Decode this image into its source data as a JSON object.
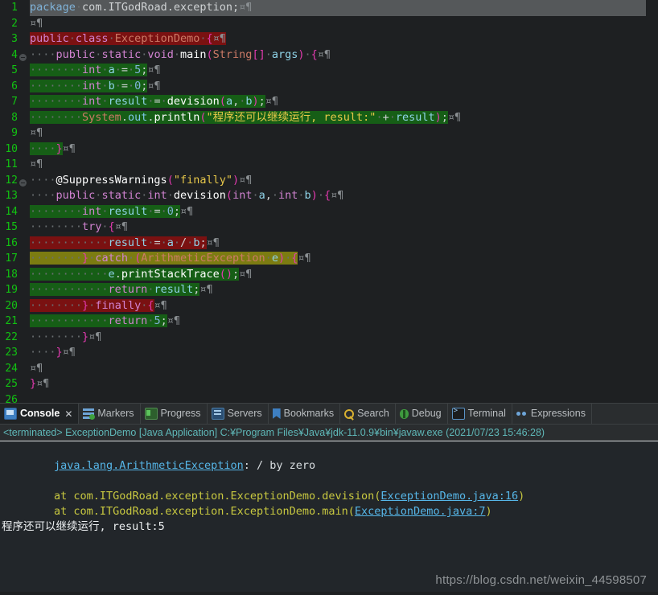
{
  "editor": {
    "language": "java",
    "lines": [
      {
        "n": "1",
        "fold": false,
        "hl": "gray",
        "indent": 0,
        "tokens": [
          {
            "t": "package",
            "c": "kw2"
          },
          {
            "t": "·",
            "c": "dot"
          },
          {
            "t": "com.ITGodRoad.exception",
            "c": "plain"
          },
          {
            "t": ";",
            "c": "plain"
          },
          {
            "t": "¤¶",
            "c": "pilc"
          }
        ]
      },
      {
        "n": "2",
        "fold": false,
        "hl": "none",
        "indent": 0,
        "tokens": [
          {
            "t": "¤¶",
            "c": "pilc"
          }
        ]
      },
      {
        "n": "3",
        "fold": false,
        "hl": "red",
        "indent": 0,
        "tokens": [
          {
            "t": "public",
            "c": "kw"
          },
          {
            "t": "·",
            "c": "dot"
          },
          {
            "t": "class",
            "c": "kw"
          },
          {
            "t": "·",
            "c": "dot"
          },
          {
            "t": "ExceptionDemo",
            "c": "typ"
          },
          {
            "t": "·",
            "c": "dot"
          },
          {
            "t": "{",
            "c": "pun"
          },
          {
            "t": "¤¶",
            "c": "pilc"
          }
        ]
      },
      {
        "n": "4",
        "fold": true,
        "hl": "none",
        "indent": 0,
        "tokens": [
          {
            "t": "····",
            "c": "dot"
          },
          {
            "t": "public",
            "c": "kw"
          },
          {
            "t": "·",
            "c": "dot"
          },
          {
            "t": "static",
            "c": "kw"
          },
          {
            "t": "·",
            "c": "dot"
          },
          {
            "t": "void",
            "c": "kw"
          },
          {
            "t": "·",
            "c": "dot"
          },
          {
            "t": "main",
            "c": "fn"
          },
          {
            "t": "(",
            "c": "pun"
          },
          {
            "t": "String",
            "c": "typ"
          },
          {
            "t": "[]",
            "c": "pun"
          },
          {
            "t": "·",
            "c": "dot"
          },
          {
            "t": "args",
            "c": "var"
          },
          {
            "t": ")",
            "c": "pun"
          },
          {
            "t": "·",
            "c": "dot"
          },
          {
            "t": "{",
            "c": "pun"
          },
          {
            "t": "¤¶",
            "c": "pilc"
          }
        ]
      },
      {
        "n": "5",
        "fold": false,
        "hl": "green",
        "indent": 0,
        "tokens": [
          {
            "t": "········",
            "c": "dot"
          },
          {
            "t": "int",
            "c": "kw"
          },
          {
            "t": "·",
            "c": "dot"
          },
          {
            "t": "a",
            "c": "var"
          },
          {
            "t": "·",
            "c": "dot"
          },
          {
            "t": "=",
            "c": "plain"
          },
          {
            "t": "·",
            "c": "dot"
          },
          {
            "t": "5",
            "c": "num"
          },
          {
            "t": ";",
            "c": "plain"
          },
          {
            "t": "¤¶",
            "c": "pilc",
            "nohl": true
          }
        ]
      },
      {
        "n": "6",
        "fold": false,
        "hl": "green",
        "indent": 0,
        "tokens": [
          {
            "t": "········",
            "c": "dot"
          },
          {
            "t": "int",
            "c": "kw"
          },
          {
            "t": "·",
            "c": "dot"
          },
          {
            "t": "b",
            "c": "var"
          },
          {
            "t": "·",
            "c": "dot"
          },
          {
            "t": "=",
            "c": "plain"
          },
          {
            "t": "·",
            "c": "dot"
          },
          {
            "t": "0",
            "c": "num"
          },
          {
            "t": ";",
            "c": "plain"
          },
          {
            "t": "¤¶",
            "c": "pilc",
            "nohl": true
          }
        ]
      },
      {
        "n": "7",
        "fold": false,
        "hl": "green",
        "indent": 0,
        "tokens": [
          {
            "t": "········",
            "c": "dot"
          },
          {
            "t": "int",
            "c": "kw"
          },
          {
            "t": "·",
            "c": "dot"
          },
          {
            "t": "result",
            "c": "var"
          },
          {
            "t": "·",
            "c": "dot"
          },
          {
            "t": "=",
            "c": "plain"
          },
          {
            "t": "·",
            "c": "dot"
          },
          {
            "t": "devision",
            "c": "fn"
          },
          {
            "t": "(",
            "c": "pun"
          },
          {
            "t": "a",
            "c": "var"
          },
          {
            "t": ",",
            "c": "plain"
          },
          {
            "t": "·",
            "c": "dot"
          },
          {
            "t": "b",
            "c": "var"
          },
          {
            "t": ")",
            "c": "pun"
          },
          {
            "t": ";",
            "c": "plain"
          },
          {
            "t": "¤¶",
            "c": "pilc",
            "nohl": true
          }
        ]
      },
      {
        "n": "8",
        "fold": false,
        "hl": "green",
        "indent": 0,
        "tokens": [
          {
            "t": "········",
            "c": "dot"
          },
          {
            "t": "System",
            "c": "typ"
          },
          {
            "t": ".",
            "c": "plain"
          },
          {
            "t": "out",
            "c": "fieldv"
          },
          {
            "t": ".",
            "c": "plain"
          },
          {
            "t": "println",
            "c": "fn"
          },
          {
            "t": "(",
            "c": "pun"
          },
          {
            "t": "\"程序还可以继续运行, result:\"",
            "c": "str"
          },
          {
            "t": "·",
            "c": "dot"
          },
          {
            "t": "+",
            "c": "plain"
          },
          {
            "t": "·",
            "c": "dot"
          },
          {
            "t": "result",
            "c": "var"
          },
          {
            "t": ")",
            "c": "pun"
          },
          {
            "t": ";",
            "c": "plain"
          },
          {
            "t": "¤¶",
            "c": "pilc",
            "nohl": true
          }
        ]
      },
      {
        "n": "9",
        "fold": false,
        "hl": "none",
        "indent": 0,
        "tokens": [
          {
            "t": "¤¶",
            "c": "pilc"
          }
        ]
      },
      {
        "n": "10",
        "fold": false,
        "hl": "green",
        "indent": 0,
        "tokens": [
          {
            "t": "····",
            "c": "dot"
          },
          {
            "t": "}",
            "c": "pun"
          },
          {
            "t": "¤¶",
            "c": "pilc",
            "nohl": true
          }
        ]
      },
      {
        "n": "11",
        "fold": false,
        "hl": "none",
        "indent": 0,
        "tokens": [
          {
            "t": "¤¶",
            "c": "pilc"
          }
        ]
      },
      {
        "n": "12",
        "fold": true,
        "hl": "none",
        "indent": 0,
        "tokens": [
          {
            "t": "····",
            "c": "dot"
          },
          {
            "t": "@SuppressWarnings",
            "c": "ann"
          },
          {
            "t": "(",
            "c": "pun"
          },
          {
            "t": "\"finally\"",
            "c": "str"
          },
          {
            "t": ")",
            "c": "pun"
          },
          {
            "t": "¤¶",
            "c": "pilc"
          }
        ]
      },
      {
        "n": "13",
        "fold": false,
        "hl": "none",
        "indent": 0,
        "tokens": [
          {
            "t": "····",
            "c": "dot"
          },
          {
            "t": "public",
            "c": "kw"
          },
          {
            "t": "·",
            "c": "dot"
          },
          {
            "t": "static",
            "c": "kw"
          },
          {
            "t": "·",
            "c": "dot"
          },
          {
            "t": "int",
            "c": "kw"
          },
          {
            "t": "·",
            "c": "dot"
          },
          {
            "t": "devision",
            "c": "fn"
          },
          {
            "t": "(",
            "c": "pun"
          },
          {
            "t": "int",
            "c": "kw"
          },
          {
            "t": "·",
            "c": "dot"
          },
          {
            "t": "a",
            "c": "var"
          },
          {
            "t": ",",
            "c": "plain"
          },
          {
            "t": "·",
            "c": "dot"
          },
          {
            "t": "int",
            "c": "kw"
          },
          {
            "t": "·",
            "c": "dot"
          },
          {
            "t": "b",
            "c": "var"
          },
          {
            "t": ")",
            "c": "pun"
          },
          {
            "t": "·",
            "c": "dot"
          },
          {
            "t": "{",
            "c": "pun"
          },
          {
            "t": "¤¶",
            "c": "pilc"
          }
        ]
      },
      {
        "n": "14",
        "fold": false,
        "hl": "green",
        "indent": 0,
        "tokens": [
          {
            "t": "········",
            "c": "dot"
          },
          {
            "t": "int",
            "c": "kw"
          },
          {
            "t": "·",
            "c": "dot"
          },
          {
            "t": "result",
            "c": "var"
          },
          {
            "t": "·",
            "c": "dot"
          },
          {
            "t": "=",
            "c": "plain"
          },
          {
            "t": "·",
            "c": "dot"
          },
          {
            "t": "0",
            "c": "num"
          },
          {
            "t": ";",
            "c": "plain"
          },
          {
            "t": "¤¶",
            "c": "pilc",
            "nohl": true
          }
        ]
      },
      {
        "n": "15",
        "fold": false,
        "hl": "none",
        "indent": 0,
        "tokens": [
          {
            "t": "········",
            "c": "dot"
          },
          {
            "t": "try",
            "c": "kw"
          },
          {
            "t": "·",
            "c": "dot"
          },
          {
            "t": "{",
            "c": "pun"
          },
          {
            "t": "¤¶",
            "c": "pilc"
          }
        ]
      },
      {
        "n": "16",
        "fold": false,
        "hl": "red",
        "indent": 0,
        "tokens": [
          {
            "t": "············",
            "c": "dot"
          },
          {
            "t": "result",
            "c": "var"
          },
          {
            "t": "·",
            "c": "dot"
          },
          {
            "t": "=",
            "c": "plain"
          },
          {
            "t": "·",
            "c": "dot"
          },
          {
            "t": "a",
            "c": "var"
          },
          {
            "t": "·",
            "c": "dot"
          },
          {
            "t": "/",
            "c": "plain"
          },
          {
            "t": "·",
            "c": "dot"
          },
          {
            "t": "b",
            "c": "var"
          },
          {
            "t": ";",
            "c": "plain"
          },
          {
            "t": "¤¶",
            "c": "pilc",
            "nohl": true
          }
        ]
      },
      {
        "n": "17",
        "fold": false,
        "hl": "olive",
        "indent": 0,
        "tokens": [
          {
            "t": "········",
            "c": "dot"
          },
          {
            "t": "}",
            "c": "pun"
          },
          {
            "t": "·",
            "c": "dot"
          },
          {
            "t": "catch",
            "c": "kw"
          },
          {
            "t": "·",
            "c": "dot"
          },
          {
            "t": "(",
            "c": "pun"
          },
          {
            "t": "ArithmeticException",
            "c": "typ"
          },
          {
            "t": "·",
            "c": "dot"
          },
          {
            "t": "e",
            "c": "var"
          },
          {
            "t": ")",
            "c": "pun"
          },
          {
            "t": "·",
            "c": "dot"
          },
          {
            "t": "{",
            "c": "pun"
          },
          {
            "t": "¤¶",
            "c": "pilc",
            "nohl": true
          }
        ]
      },
      {
        "n": "18",
        "fold": false,
        "hl": "green",
        "indent": 0,
        "tokens": [
          {
            "t": "············",
            "c": "dot"
          },
          {
            "t": "e",
            "c": "var"
          },
          {
            "t": ".",
            "c": "plain"
          },
          {
            "t": "printStackTrace",
            "c": "fn"
          },
          {
            "t": "(",
            "c": "pun"
          },
          {
            "t": ")",
            "c": "pun"
          },
          {
            "t": ";",
            "c": "plain"
          },
          {
            "t": "¤¶",
            "c": "pilc",
            "nohl": true
          }
        ]
      },
      {
        "n": "19",
        "fold": false,
        "hl": "green",
        "indent": 0,
        "tokens": [
          {
            "t": "············",
            "c": "dot"
          },
          {
            "t": "return",
            "c": "kw"
          },
          {
            "t": "·",
            "c": "dot"
          },
          {
            "t": "result",
            "c": "var"
          },
          {
            "t": ";",
            "c": "plain"
          },
          {
            "t": "¤¶",
            "c": "pilc",
            "nohl": true
          }
        ]
      },
      {
        "n": "20",
        "fold": false,
        "hl": "red",
        "indent": 0,
        "tokens": [
          {
            "t": "········",
            "c": "dot"
          },
          {
            "t": "}",
            "c": "pun"
          },
          {
            "t": "·",
            "c": "dot"
          },
          {
            "t": "finally",
            "c": "kw"
          },
          {
            "t": "·",
            "c": "dot"
          },
          {
            "t": "{",
            "c": "pun"
          },
          {
            "t": "¤¶",
            "c": "pilc",
            "nohl": true
          }
        ]
      },
      {
        "n": "21",
        "fold": false,
        "hl": "green",
        "indent": 0,
        "tokens": [
          {
            "t": "············",
            "c": "dot"
          },
          {
            "t": "return",
            "c": "kw"
          },
          {
            "t": "·",
            "c": "dot"
          },
          {
            "t": "5",
            "c": "num"
          },
          {
            "t": ";",
            "c": "plain"
          },
          {
            "t": "¤¶",
            "c": "pilc",
            "nohl": true
          }
        ]
      },
      {
        "n": "22",
        "fold": false,
        "hl": "none",
        "indent": 0,
        "tokens": [
          {
            "t": "········",
            "c": "dot"
          },
          {
            "t": "}",
            "c": "pun"
          },
          {
            "t": "¤¶",
            "c": "pilc"
          }
        ]
      },
      {
        "n": "23",
        "fold": false,
        "hl": "none",
        "indent": 0,
        "tokens": [
          {
            "t": "····",
            "c": "dot"
          },
          {
            "t": "}",
            "c": "pun"
          },
          {
            "t": "¤¶",
            "c": "pilc"
          }
        ]
      },
      {
        "n": "24",
        "fold": false,
        "hl": "none",
        "indent": 0,
        "tokens": [
          {
            "t": "¤¶",
            "c": "pilc"
          }
        ]
      },
      {
        "n": "25",
        "fold": false,
        "hl": "none",
        "indent": 0,
        "tokens": [
          {
            "t": "}",
            "c": "pun"
          },
          {
            "t": "¤¶",
            "c": "pilc"
          }
        ]
      },
      {
        "n": "26",
        "fold": false,
        "hl": "none",
        "indent": 0,
        "tokens": []
      }
    ]
  },
  "panel": {
    "tabs": [
      {
        "label": "Console",
        "icon": "console-monitor-icon",
        "active": true,
        "closable": true
      },
      {
        "label": "Markers",
        "icon": "markers-icon",
        "active": false,
        "closable": false
      },
      {
        "label": "Progress",
        "icon": "progress-icon",
        "active": false,
        "closable": false
      },
      {
        "label": "Servers",
        "icon": "servers-icon",
        "active": false,
        "closable": false
      },
      {
        "label": "Bookmarks",
        "icon": "bookmark-icon",
        "active": false,
        "closable": false
      },
      {
        "label": "Search",
        "icon": "search-icon",
        "active": false,
        "closable": false
      },
      {
        "label": "Debug",
        "icon": "debug-bug-icon",
        "active": false,
        "closable": false
      },
      {
        "label": "Terminal",
        "icon": "terminal-icon",
        "active": false,
        "closable": false
      },
      {
        "label": "Expressions",
        "icon": "expressions-icon",
        "active": false,
        "closable": false
      }
    ],
    "close_glyph": "✕",
    "launch_header": "<terminated> ExceptionDemo [Java Application] C:¥Program Files¥Java¥jdk-11.0.9¥bin¥javaw.exe (2021/07/23 15:46:28)",
    "console": {
      "exception_type": "java.lang.ArithmeticException",
      "exception_message": ": / by zero",
      "stack": [
        {
          "prefix": "        at com.ITGodRoad.exception.ExceptionDemo.devision(",
          "link": "ExceptionDemo.java:16",
          "suffix": ")"
        },
        {
          "prefix": "        at com.ITGodRoad.exception.ExceptionDemo.main(",
          "link": "ExceptionDemo.java:7",
          "suffix": ")"
        }
      ],
      "stdout": "程序还可以继续运行, result:5"
    }
  },
  "watermark": {
    "text": "https://blog.csdn.net/weixin_44598507"
  },
  "colors": {
    "editor_bg": "#1e2022",
    "panel_bg": "#2a2d2f",
    "console_bg": "#22262a",
    "line_number": "#12c212",
    "hl_green": "#165e16",
    "hl_red": "#7a1111",
    "hl_olive": "#7c7c11",
    "hl_gray": "#55585a",
    "link": "#56b6e8",
    "trace": "#c8c840",
    "string": "#e8c84a",
    "keyword": "#d183d1"
  }
}
